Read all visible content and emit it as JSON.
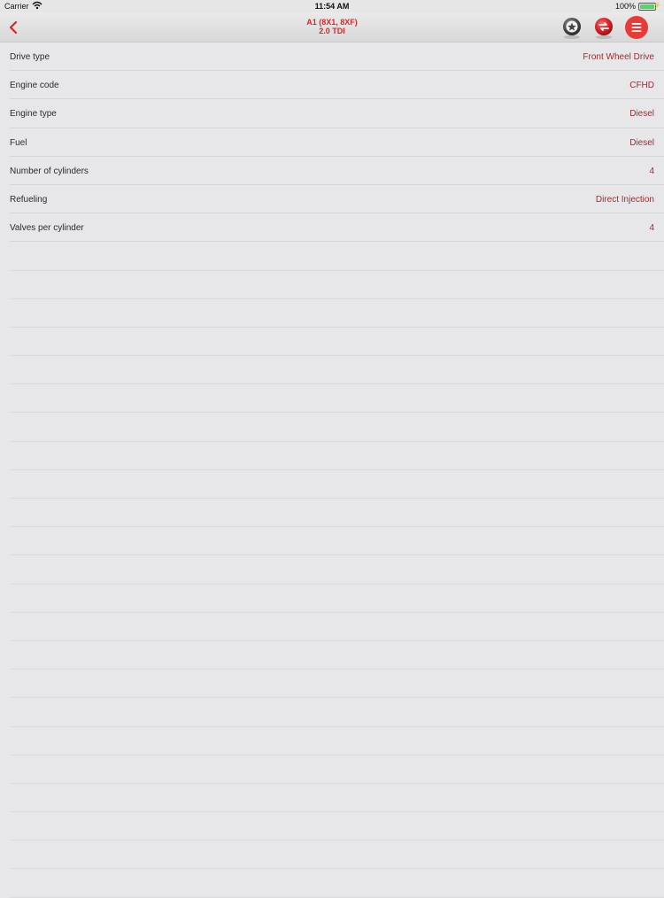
{
  "status_bar": {
    "carrier": "Carrier",
    "time": "11:54 AM",
    "battery": "100%",
    "battery_level": 1.0
  },
  "nav": {
    "title_line1": "A1 (8X1, 8XF)",
    "title_line2": "2.0 TDI",
    "accent_color": "#d9262b"
  },
  "specs": [
    {
      "label": "Drive type",
      "value": "Front Wheel Drive"
    },
    {
      "label": "Engine code",
      "value": "CFHD"
    },
    {
      "label": "Engine type",
      "value": "Diesel"
    },
    {
      "label": "Fuel",
      "value": "Diesel"
    },
    {
      "label": "Number of cylinders",
      "value": "4"
    },
    {
      "label": "Refueling",
      "value": "Direct Injection"
    },
    {
      "label": "Valves per cylinder",
      "value": "4"
    }
  ],
  "icons": {
    "back": "chevron-left-icon",
    "favorite": "star-icon",
    "exchange": "exchange-icon",
    "menu": "hamburger-menu-icon"
  }
}
